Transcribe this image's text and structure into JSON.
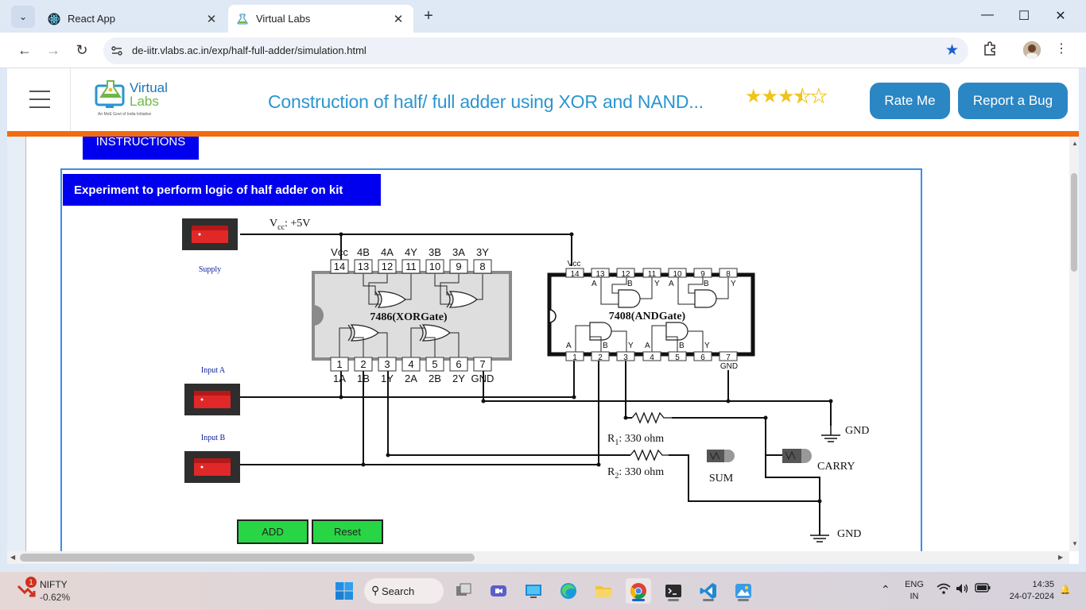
{
  "browser": {
    "tabs": [
      {
        "title": "React App",
        "active": false
      },
      {
        "title": "Virtual Labs",
        "active": true
      }
    ],
    "new_tab": "+",
    "url": "de-iitr.vlabs.ac.in/exp/half-full-adder/simulation.html"
  },
  "header": {
    "logo_line1": "Virtual",
    "logo_line2": "Labs",
    "logo_tagline": "An MoE Govt of India Initiative",
    "title": "Construction of half/ full adder using XOR and NAND...",
    "rating": 3.5,
    "rate_button": "Rate Me",
    "bug_button": "Report a Bug",
    "accent_color": "#f26b0f",
    "button_color": "#2b86c4"
  },
  "sim": {
    "instructions_label": "INSTRUCTIONS",
    "heading": "Experiment to perform logic of half adder on kit",
    "supply_label": "Supply",
    "input_a_label": "Input A",
    "input_b_label": "Input B",
    "vcc_label": "V",
    "vcc_sub": "cc",
    "vcc_value": ": +5V",
    "xor_chip": {
      "name": "7486(XORGate)",
      "top_labels": [
        "Vcc",
        "4B",
        "4A",
        "4Y",
        "3B",
        "3A",
        "3Y"
      ],
      "top_pins": [
        "14",
        "13",
        "12",
        "11",
        "10",
        "9",
        "8"
      ],
      "bottom_pins": [
        "1",
        "2",
        "3",
        "4",
        "5",
        "6",
        "7"
      ],
      "bottom_labels": [
        "1A",
        "1B",
        "1Y",
        "2A",
        "2B",
        "2Y",
        "GND"
      ]
    },
    "and_chip": {
      "name": "7408(ANDGate)",
      "vcc_label": "Vcc",
      "gnd_label": "GND",
      "top_pins": [
        "14",
        "13",
        "12",
        "11",
        "10",
        "9",
        "8"
      ],
      "bottom_pins": [
        "1",
        "2",
        "3",
        "4",
        "5",
        "6",
        "7"
      ],
      "pin_letters": [
        "A",
        "B",
        "Y",
        "A",
        "B",
        "Y",
        "A",
        "B",
        "Y",
        "A",
        "B",
        "Y"
      ]
    },
    "r1_label": "R",
    "r1_sub": "1",
    "r1_value": ": 330 ohm",
    "r2_label": "R",
    "r2_sub": "2",
    "r2_value": ": 330 ohm",
    "sum_label": "SUM",
    "carry_label": "CARRY",
    "gnd_label": "GND",
    "add_button": "ADD",
    "reset_button": "Reset"
  },
  "taskbar": {
    "stock_name": "NIFTY",
    "stock_change": "-0.62%",
    "stock_badge": "1",
    "search_label": "Search",
    "lang_line1": "ENG",
    "lang_line2": "IN",
    "time": "14:35",
    "date": "24-07-2024"
  }
}
